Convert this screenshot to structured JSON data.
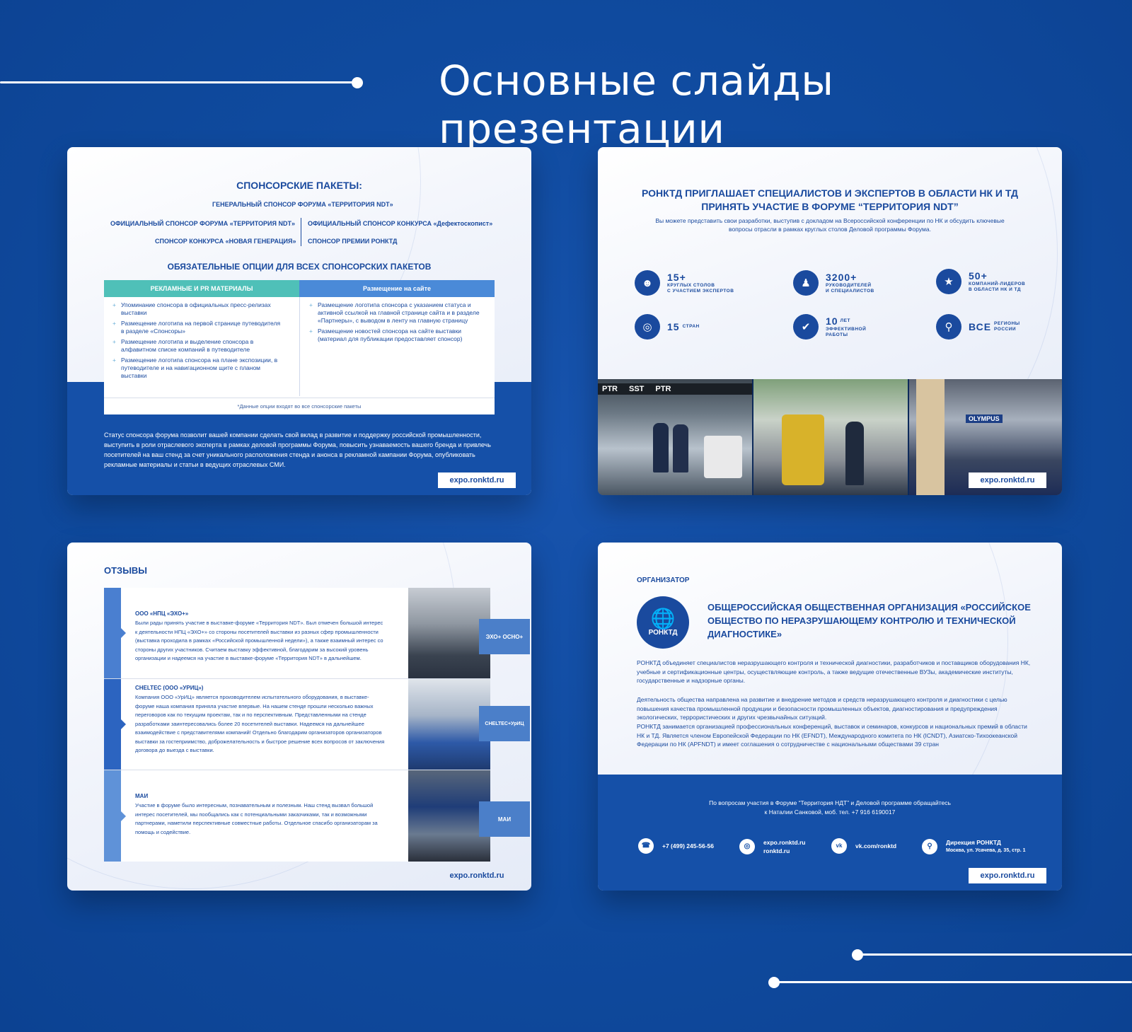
{
  "page": {
    "title": "Основные слайды презентации"
  },
  "url": "expo.ronktd.ru",
  "slide1": {
    "heading": "СПОНСОРСКИЕ ПАКЕТЫ:",
    "general": "ГЕНЕРАЛЬНЫЙ СПОНСОР ФОРУМА «ТЕРРИТОРИЯ NDT»",
    "official": "ОФИЦИАЛЬНЫЙ СПОНСОР ФОРУМА «ТЕРРИТОРИЯ NDT»",
    "contest_sponsor": "ОФИЦИАЛЬНЫЙ СПОНСОР КОНКУРСА «Дефектоскопист»",
    "new_gen": "СПОНСОР КОНКУРСА «НОВАЯ ГЕНЕРАЦИЯ»",
    "prize": "СПОНСОР ПРЕМИИ РОНКТД",
    "options_heading": "ОБЯЗАТЕЛЬНЫЕ ОПЦИИ ДЛЯ ВСЕХ СПОНСОРСКИХ ПАКЕТОВ",
    "col1_title": "РЕКЛАМНЫЕ И PR МАТЕРИАЛЫ",
    "col2_title": "Размещение на сайте",
    "col1_items": [
      "Упоминание спонсора в официальных пресс-релизах выставки",
      "Размещение логотипа на первой странице путеводителя в разделе «Спонсоры»",
      "Размещение логотипа и выделение спонсора в алфавитном списке компаний в путеводителе",
      "Размещение логотипа спонсора на плане экспозиции, в путеводителе и на навигационном щите с планом выставки"
    ],
    "col2_items": [
      "Размещение логотипа спонсора с указанием статуса и активной ссылкой на главной странице сайта и в разделе «Партнеры», с выводом в ленту на главную страницу",
      "Размещение новостей спонсора на сайте выставки (материал для публикации предоставляет спонсор)"
    ],
    "note": "*Данные опции входят во все спонсорские пакеты",
    "paragraph": "Статус спонсора форума позволит вашей компании сделать свой вклад в развитие и поддержку российской промышленности, выступить в роли отраслевого эксперта в рамках деловой программы Форума, повысить узнаваемость вашего бренда и привлечь посетителей на ваш стенд за счет уникального расположения стенда и анонса в рекламной кампании Форума, опубликовать рекламные материалы и статьи в ведущих отраслевых СМИ."
  },
  "slide2": {
    "heading1": "РОНКТД ПРИГЛАШАЕТ СПЕЦИАЛИСТОВ И ЭКСПЕРТОВ В ОБЛАСТИ НК И ТД",
    "heading2": "ПРИНЯТЬ УЧАСТИЕ В ФОРУМЕ “ТЕРРИТОРИЯ NDT”",
    "subtitle": "Вы можете представить свои разработки, выступив с докладом на Всероссийской конференции по НК и обсудить ключевые вопросы отрасли в рамках круглых столов Деловой программы Форума.",
    "stats": [
      {
        "num": "15+",
        "label1": "КРУГЛЫХ СТОЛОВ",
        "label2": "С УЧАСТИЕМ ЭКСПЕРТОВ",
        "icon": "user-icon"
      },
      {
        "num": "3200+",
        "label1": "РУКОВОДИТЕЛЕЙ",
        "label2": "И СПЕЦИАЛИСТОВ",
        "icon": "people-icon"
      },
      {
        "num": "50+",
        "label1": "КОМПАНИЙ-ЛИДЕРОВ",
        "label2": "В ОБЛАСТИ НК И ТД",
        "icon": "trophy-icon"
      },
      {
        "num": "15",
        "label1": "СТРАН",
        "label2": "",
        "icon": "globe-icon"
      },
      {
        "num": "10",
        "label1": "ЛЕТ",
        "label2": "ЭФФЕКТИВНОЙ РАБОТЫ",
        "icon": "thumbs-up-icon"
      },
      {
        "num": "ВСЕ",
        "label1": "РЕГИОНЫ",
        "label2": "РОССИИ",
        "icon": "map-icon"
      }
    ],
    "photo_text1": "PTR",
    "photo_text2": "SST",
    "photo_text3": "OLYMPUS"
  },
  "slide3": {
    "heading": "ОТЗЫВЫ",
    "reviews": [
      {
        "name": "ООО «НПЦ «ЭХО+»",
        "logo": "ЭХО+ ОСНО+",
        "text": "Были рады принять участие в выставке-форуме «Территория NDT». Был отмечен большой интерес к деятельности НПЦ «ЭХО+» со стороны посетителей выставки из разных сфер промышленности (выставка проходила в рамках «Российской промышленной недели»), а также взаимный интерес со стороны других участников. Считаем выставку эффективной, благодарим за высокий уровень организации и надеемся на участие в выставке-форуме «Территория NDT» в дальнейшем."
      },
      {
        "name": "CHELTEC (ООО «УРИЦ»)",
        "logo": "CHELTEC+УрИЦ",
        "text": "Компания ООО «УрИЦ» является производителем испытательного оборудования, в выставке-форуме наша компания приняла участие впервые. На нашем стенде прошли несколько важных переговоров как по текущим проектам, так и по перспективным. Представленными на стенде разработками заинтересовались более 20 посетителей выставки. Надеемся на дальнейшее взаимодействие с представителями компаний! Отдельно благодарим организаторов организаторов выставки за гостеприимство, доброжелательность и быстрое решение всех вопросов от заключения договора до выезда с выставки."
      },
      {
        "name": "МАИ",
        "logo": "МАИ",
        "text": "Участие в форуме было интересным, познавательным и полезным. Наш стенд вызвал большой интерес посетителей, мы пообщались как с потенциальными заказчиками, так и возможными партнерами, наметили перспективные совместные работы. Отдельное спасибо организаторам за помощь и содействие."
      }
    ]
  },
  "slide4": {
    "org_label": "ОРГАНИЗАТОР",
    "emblem_text": "РОНКТД",
    "title": "ОБЩЕРОССИЙСКАЯ ОБЩЕСТВЕННАЯ ОРГАНИЗАЦИЯ «РОССИЙСКОЕ ОБЩЕСТВО ПО НЕРАЗРУШАЮЩЕМУ КОНТРОЛЮ И ТЕХНИЧЕСКОЙ ДИАГНОСТИКЕ»",
    "p1": "РОНКТД объединяет специалистов неразрушающего контроля и технической диагностики, разработчиков и поставщиков оборудования НК, учебные и сертификационные центры, осуществляющие контроль, а также ведущие отечественные ВУЗы, академические институты, государственные и надзорные органы.",
    "p2": "Деятельность общества направлена на развитие и внедрение методов и средств неразрушающего контроля и диагностики с целью повышения качества промышленной продукции и безопасности промышленных объектов, диагностирования и предупреждения экологических, террористических и других чрезвычайных ситуаций.",
    "p3": "РОНКТД занимается организацией профессиональных конференций, выставок и семинаров, конкурсов и национальных премий в области НК и ТД. Является членом Европейской Федерации по НК (EFNDT), Международного комитета по НК (ICNDT), Азиатско-Тихоокеанской Федерации по НК (APFNDT) и имеет соглашения о сотрудничестве с национальными обществами 39 стран",
    "contact1": "По вопросам участия в Форуме “Территория НДТ” и Деловой программе обращайтесь",
    "contact2": "к Наталии Санковой, моб. тел. +7 916 6190017",
    "phone": "+7 (499) 245-56-56",
    "web1": "expo.ronktd.ru",
    "web2": "ronktd.ru",
    "vk": "vk.com/ronktd",
    "addr1": "Дирекция РОНКТД",
    "addr2": "Москва, ул. Усачева, д. 35, стр. 1"
  }
}
